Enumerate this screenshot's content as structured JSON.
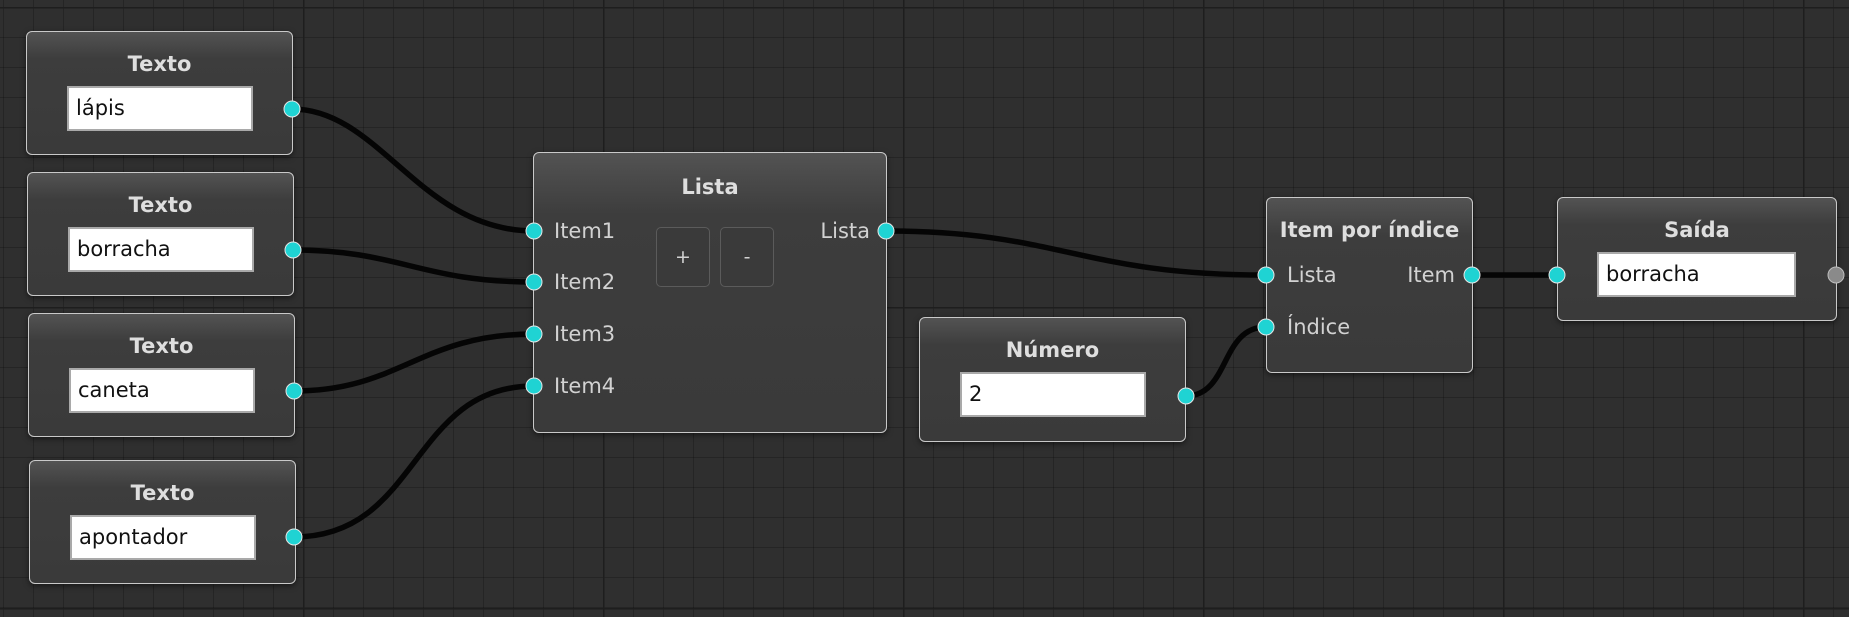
{
  "text_nodes": [
    {
      "title": "Texto",
      "value": "lápis"
    },
    {
      "title": "Texto",
      "value": "borracha"
    },
    {
      "title": "Texto",
      "value": "caneta"
    },
    {
      "title": "Texto",
      "value": "apontador"
    }
  ],
  "list_node": {
    "title": "Lista",
    "inputs": [
      "Item1",
      "Item2",
      "Item3",
      "Item4"
    ],
    "output": "Lista",
    "add_label": "+",
    "remove_label": "-"
  },
  "number_node": {
    "title": "Número",
    "value": "2"
  },
  "index_node": {
    "title": "Item por índice",
    "input_list": "Lista",
    "input_index": "Índice",
    "output": "Item"
  },
  "output_node": {
    "title": "Saída",
    "value": "borracha"
  },
  "colors": {
    "background": "#2f2f2f",
    "port": "#1fd3d3",
    "wire": "#050505",
    "node_border": "#c9c9c9"
  }
}
